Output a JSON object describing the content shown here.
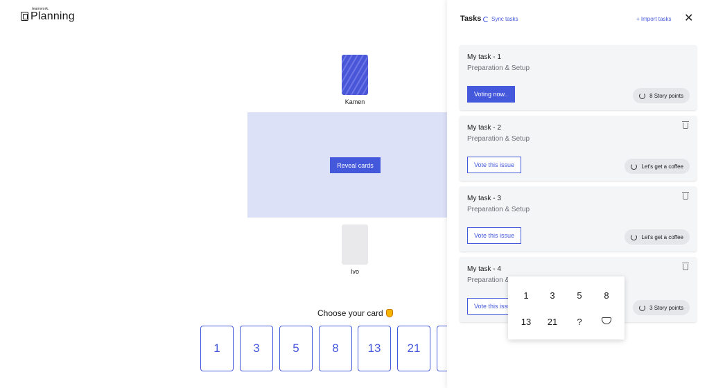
{
  "logo": {
    "small_text": "teamwork.",
    "big_text": "Planning"
  },
  "players": [
    {
      "name": "Kamen",
      "state": "card-back"
    },
    {
      "name": "Ivo",
      "state": "empty"
    }
  ],
  "table": {
    "reveal_label": "Reveal cards"
  },
  "choose": {
    "title": "Choose your card",
    "cards": [
      "1",
      "3",
      "5",
      "8",
      "13",
      "21"
    ]
  },
  "panel": {
    "title": "Tasks",
    "sync_label": "Sync tasks",
    "import_label": "+ Import tasks",
    "close_glyph": "✕"
  },
  "tasks": [
    {
      "title": "My task - 1",
      "subtitle": "Preparation & Setup",
      "button": "Voting now..",
      "points": "8 Story points"
    },
    {
      "title": "My task - 2",
      "subtitle": "Preparation & Setup",
      "button": "Vote this issue",
      "points": "Let's get a coffee"
    },
    {
      "title": "My task - 3",
      "subtitle": "Preparation & Setup",
      "button": "Vote this issue",
      "points": "Let's get a coffee"
    },
    {
      "title": "My task - 4",
      "subtitle": "Preparation & Setup",
      "button": "Vote this issue",
      "points": "3 Story points"
    }
  ],
  "popup": {
    "values": [
      "1",
      "3",
      "5",
      "8",
      "13",
      "21",
      "?"
    ],
    "coffee_icon": "coffee-cup-icon"
  },
  "colors": {
    "accent": "#4458dc",
    "table": "#dde1f7",
    "card_back": "#4a56d8"
  }
}
